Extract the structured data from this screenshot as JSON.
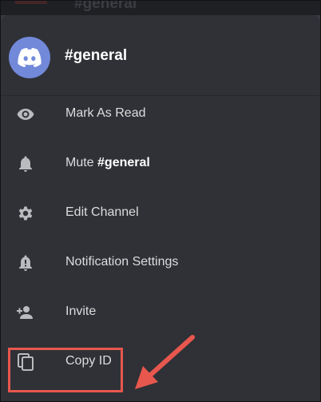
{
  "background": {
    "faded_channel_name": "#general"
  },
  "header": {
    "channel_name": "#general",
    "avatar_icon": "discord-logo-icon",
    "avatar_color": "#7289da"
  },
  "menu": {
    "items": [
      {
        "label": "Mark As Read",
        "icon": "eye-icon"
      },
      {
        "label_prefix": "Mute ",
        "label_bold": "#general",
        "icon": "bell-icon"
      },
      {
        "label": "Edit Channel",
        "icon": "gear-icon"
      },
      {
        "label": "Notification Settings",
        "icon": "bell-alert-icon"
      },
      {
        "label": "Invite",
        "icon": "add-person-icon"
      },
      {
        "label": "Copy ID",
        "icon": "copy-icon"
      }
    ]
  },
  "annotation": {
    "highlight_color": "#e8574e"
  }
}
